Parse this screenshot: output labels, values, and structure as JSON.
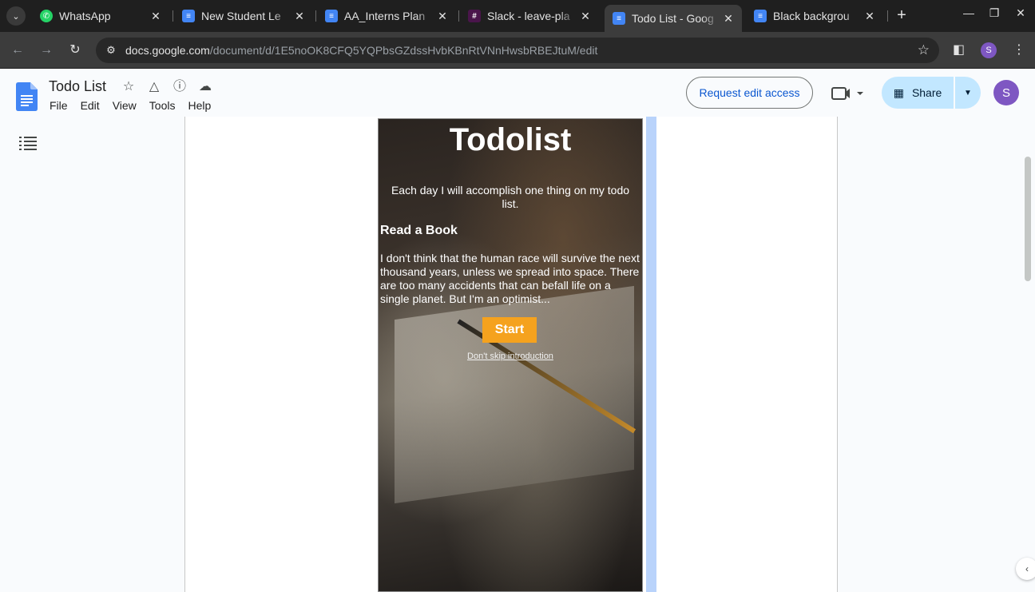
{
  "browser": {
    "tabs": [
      {
        "title": "WhatsApp",
        "icon": "whatsapp-icon",
        "color": "#25d366"
      },
      {
        "title": "New Student Le",
        "icon": "docs-icon",
        "color": "#4285f4"
      },
      {
        "title": "AA_Interns Plan",
        "icon": "docs-icon",
        "color": "#4285f4"
      },
      {
        "title": "Slack - leave-pla",
        "icon": "slack-icon",
        "color": "#e01e5a"
      },
      {
        "title": "Todo List - Goog",
        "icon": "docs-icon",
        "color": "#4285f4",
        "active": true
      },
      {
        "title": "Black backgrou",
        "icon": "docs-icon",
        "color": "#4285f4"
      }
    ],
    "url_host": "docs.google.com",
    "url_path": "/document/d/1E5noOK8CFQ5YQPbsGZdssHvbKBnRtVNnHwsbRBEJtuM/edit",
    "profile_initial": "S"
  },
  "docs": {
    "title": "Todo List",
    "menu": [
      "File",
      "Edit",
      "View",
      "Tools",
      "Help"
    ],
    "request_edit_label": "Request edit access",
    "share_label": "Share",
    "avatar_initial": "S",
    "accent_color": "#c2e7ff"
  },
  "content": {
    "heading": "Todolist",
    "subtitle": "Each day I will accomplish one thing on my todo list.",
    "task_title": "Read a Book",
    "quote": "I don't think that the human race will survive the next thousand years, unless we spread into space. There are too many accidents that can befall life on a single planet. But I'm an optimist...",
    "start_label": "Start",
    "skip_label": "Don't skip introduction",
    "start_color": "#f5a21e"
  }
}
